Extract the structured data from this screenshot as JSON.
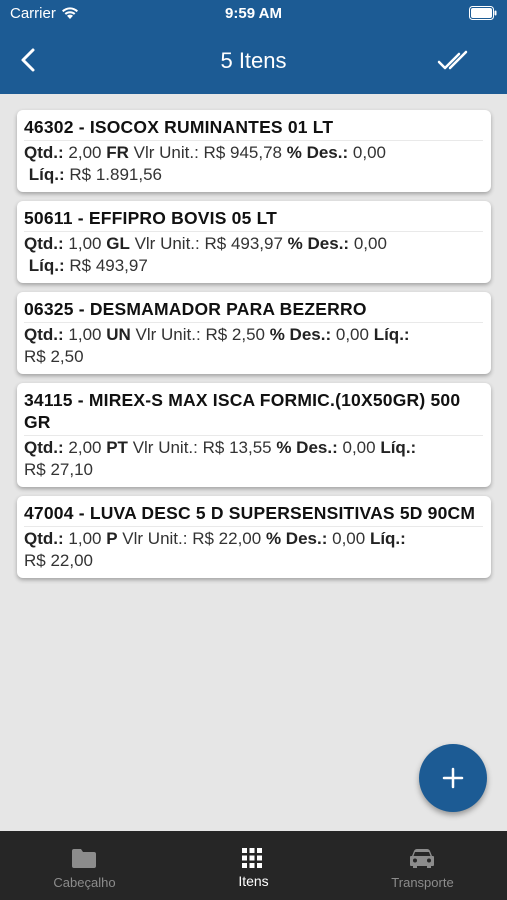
{
  "status_bar": {
    "carrier": "Carrier",
    "time": "9:59 AM"
  },
  "nav": {
    "title": "5 Itens"
  },
  "items": [
    {
      "title": "46302 - ISOCOX RUMINANTES 01 LT",
      "qtd_label": "Qtd.:",
      "qtd": "2,00",
      "unit": "FR",
      "vlr_label": "Vlr Unit.:",
      "vlr": "R$  945,78",
      "des_label": "% Des.:",
      "des": "0,00",
      "liq_label": "Líq.:",
      "liq": "R$  1.891,56"
    },
    {
      "title": "50611 - EFFIPRO BOVIS 05 LT",
      "qtd_label": "Qtd.:",
      "qtd": "1,00",
      "unit": "GL",
      "vlr_label": "Vlr Unit.:",
      "vlr": "R$  493,97",
      "des_label": "% Des.:",
      "des": "0,00",
      "liq_label": "Líq.:",
      "liq": "R$  493,97"
    },
    {
      "title": "06325 - DESMAMADOR PARA BEZERRO",
      "qtd_label": "Qtd.:",
      "qtd": "1,00",
      "unit": "UN",
      "vlr_label": "Vlr Unit.:",
      "vlr": "R$  2,50",
      "des_label": "% Des.:",
      "des": "0,00",
      "liq_label": "Líq.:",
      "liq": "R$  2,50"
    },
    {
      "title": "34115 - MIREX-S MAX ISCA FORMIC.(10X50GR) 500 GR",
      "qtd_label": "Qtd.:",
      "qtd": "2,00",
      "unit": "PT",
      "vlr_label": "Vlr Unit.:",
      "vlr": "R$  13,55",
      "des_label": "% Des.:",
      "des": "0,00",
      "liq_label": "Líq.:",
      "liq": "R$  27,10"
    },
    {
      "title": "47004 - LUVA DESC 5 D SUPERSENSITIVAS 5D 90CM",
      "qtd_label": "Qtd.:",
      "qtd": "1,00",
      "unit": "P",
      "vlr_label": "Vlr Unit.:",
      "vlr": "R$  22,00",
      "des_label": "% Des.:",
      "des": "0,00",
      "liq_label": "Líq.:",
      "liq": "R$  22,00"
    }
  ],
  "tabs": [
    {
      "label": "Cabeçalho",
      "icon": "folder-icon",
      "active": false
    },
    {
      "label": "Itens",
      "icon": "grid-icon",
      "active": true
    },
    {
      "label": "Transporte",
      "icon": "car-icon",
      "active": false
    }
  ],
  "colors": {
    "primary": "#1c5b94",
    "tab_bar": "#262626",
    "background": "#e6e6e6"
  }
}
